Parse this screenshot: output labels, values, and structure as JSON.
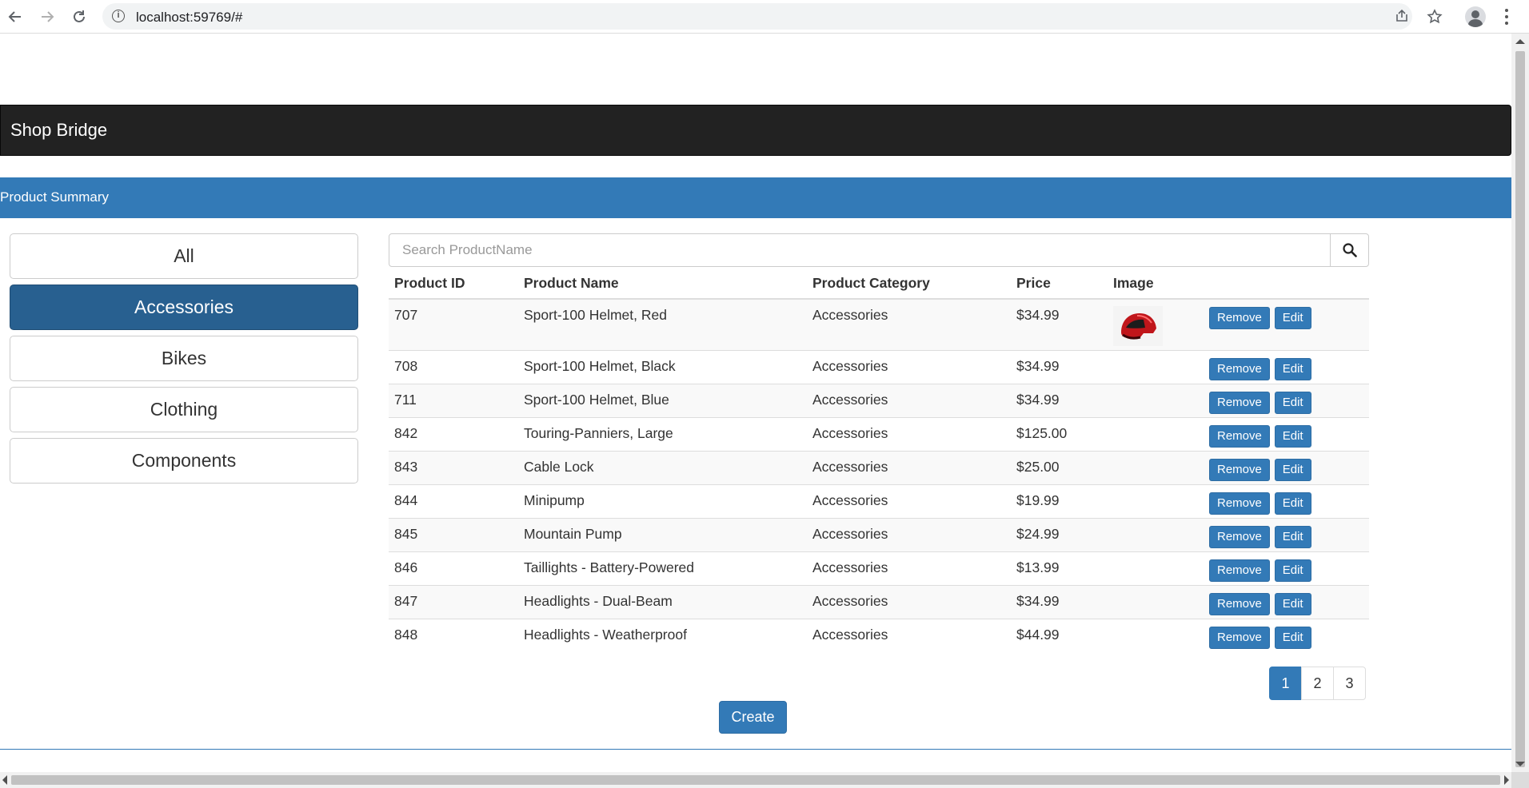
{
  "browser": {
    "url": "localhost:59769/#",
    "icons": [
      "back-arrow-icon",
      "forward-arrow-icon",
      "reload-icon",
      "site-info-icon",
      "share-icon",
      "bookmark-star-icon",
      "profile-icon",
      "menu-kebab-icon"
    ]
  },
  "navbar": {
    "brand": "Shop Bridge"
  },
  "panel": {
    "heading": "Product Summary"
  },
  "categories": [
    {
      "label": "All",
      "active": false
    },
    {
      "label": "Accessories",
      "active": true
    },
    {
      "label": "Bikes",
      "active": false
    },
    {
      "label": "Clothing",
      "active": false
    },
    {
      "label": "Components",
      "active": false
    }
  ],
  "search": {
    "placeholder": "Search ProductName",
    "value": ""
  },
  "table": {
    "headers": {
      "id": "Product ID",
      "name": "Product Name",
      "category": "Product Category",
      "price": "Price",
      "image": "Image"
    },
    "rows": [
      {
        "id": "707",
        "name": "Sport-100 Helmet, Red",
        "category": "Accessories",
        "price": "$34.99",
        "has_image": true
      },
      {
        "id": "708",
        "name": "Sport-100 Helmet, Black",
        "category": "Accessories",
        "price": "$34.99",
        "has_image": false
      },
      {
        "id": "711",
        "name": "Sport-100 Helmet, Blue",
        "category": "Accessories",
        "price": "$34.99",
        "has_image": false
      },
      {
        "id": "842",
        "name": "Touring-Panniers, Large",
        "category": "Accessories",
        "price": "$125.00",
        "has_image": false
      },
      {
        "id": "843",
        "name": "Cable Lock",
        "category": "Accessories",
        "price": "$25.00",
        "has_image": false
      },
      {
        "id": "844",
        "name": "Minipump",
        "category": "Accessories",
        "price": "$19.99",
        "has_image": false
      },
      {
        "id": "845",
        "name": "Mountain Pump",
        "category": "Accessories",
        "price": "$24.99",
        "has_image": false
      },
      {
        "id": "846",
        "name": "Taillights - Battery-Powered",
        "category": "Accessories",
        "price": "$13.99",
        "has_image": false
      },
      {
        "id": "847",
        "name": "Headlights - Dual-Beam",
        "category": "Accessories",
        "price": "$34.99",
        "has_image": false
      },
      {
        "id": "848",
        "name": "Headlights - Weatherproof",
        "category": "Accessories",
        "price": "$44.99",
        "has_image": false
      }
    ],
    "remove_label": "Remove",
    "edit_label": "Edit"
  },
  "pagination": {
    "pages": [
      "1",
      "2",
      "3"
    ],
    "current": "1"
  },
  "create_label": "Create",
  "colors": {
    "primary": "#337ab7",
    "active": "#286090",
    "navbar": "#222222"
  }
}
